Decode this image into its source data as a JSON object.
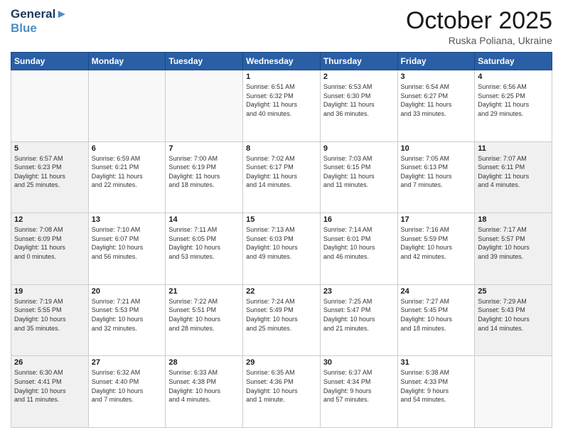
{
  "header": {
    "logo_line1": "General",
    "logo_line2": "Blue",
    "month": "October 2025",
    "location": "Ruska Poliana, Ukraine"
  },
  "weekdays": [
    "Sunday",
    "Monday",
    "Tuesday",
    "Wednesday",
    "Thursday",
    "Friday",
    "Saturday"
  ],
  "weeks": [
    [
      {
        "day": "",
        "info": "",
        "empty": true
      },
      {
        "day": "",
        "info": "",
        "empty": true
      },
      {
        "day": "",
        "info": "",
        "empty": true
      },
      {
        "day": "1",
        "info": "Sunrise: 6:51 AM\nSunset: 6:32 PM\nDaylight: 11 hours\nand 40 minutes."
      },
      {
        "day": "2",
        "info": "Sunrise: 6:53 AM\nSunset: 6:30 PM\nDaylight: 11 hours\nand 36 minutes."
      },
      {
        "day": "3",
        "info": "Sunrise: 6:54 AM\nSunset: 6:27 PM\nDaylight: 11 hours\nand 33 minutes."
      },
      {
        "day": "4",
        "info": "Sunrise: 6:56 AM\nSunset: 6:25 PM\nDaylight: 11 hours\nand 29 minutes."
      }
    ],
    [
      {
        "day": "5",
        "info": "Sunrise: 6:57 AM\nSunset: 6:23 PM\nDaylight: 11 hours\nand 25 minutes.",
        "shaded": true
      },
      {
        "day": "6",
        "info": "Sunrise: 6:59 AM\nSunset: 6:21 PM\nDaylight: 11 hours\nand 22 minutes."
      },
      {
        "day": "7",
        "info": "Sunrise: 7:00 AM\nSunset: 6:19 PM\nDaylight: 11 hours\nand 18 minutes."
      },
      {
        "day": "8",
        "info": "Sunrise: 7:02 AM\nSunset: 6:17 PM\nDaylight: 11 hours\nand 14 minutes."
      },
      {
        "day": "9",
        "info": "Sunrise: 7:03 AM\nSunset: 6:15 PM\nDaylight: 11 hours\nand 11 minutes."
      },
      {
        "day": "10",
        "info": "Sunrise: 7:05 AM\nSunset: 6:13 PM\nDaylight: 11 hours\nand 7 minutes."
      },
      {
        "day": "11",
        "info": "Sunrise: 7:07 AM\nSunset: 6:11 PM\nDaylight: 11 hours\nand 4 minutes.",
        "shaded": true
      }
    ],
    [
      {
        "day": "12",
        "info": "Sunrise: 7:08 AM\nSunset: 6:09 PM\nDaylight: 11 hours\nand 0 minutes.",
        "shaded": true
      },
      {
        "day": "13",
        "info": "Sunrise: 7:10 AM\nSunset: 6:07 PM\nDaylight: 10 hours\nand 56 minutes."
      },
      {
        "day": "14",
        "info": "Sunrise: 7:11 AM\nSunset: 6:05 PM\nDaylight: 10 hours\nand 53 minutes."
      },
      {
        "day": "15",
        "info": "Sunrise: 7:13 AM\nSunset: 6:03 PM\nDaylight: 10 hours\nand 49 minutes."
      },
      {
        "day": "16",
        "info": "Sunrise: 7:14 AM\nSunset: 6:01 PM\nDaylight: 10 hours\nand 46 minutes."
      },
      {
        "day": "17",
        "info": "Sunrise: 7:16 AM\nSunset: 5:59 PM\nDaylight: 10 hours\nand 42 minutes."
      },
      {
        "day": "18",
        "info": "Sunrise: 7:17 AM\nSunset: 5:57 PM\nDaylight: 10 hours\nand 39 minutes.",
        "shaded": true
      }
    ],
    [
      {
        "day": "19",
        "info": "Sunrise: 7:19 AM\nSunset: 5:55 PM\nDaylight: 10 hours\nand 35 minutes.",
        "shaded": true
      },
      {
        "day": "20",
        "info": "Sunrise: 7:21 AM\nSunset: 5:53 PM\nDaylight: 10 hours\nand 32 minutes."
      },
      {
        "day": "21",
        "info": "Sunrise: 7:22 AM\nSunset: 5:51 PM\nDaylight: 10 hours\nand 28 minutes."
      },
      {
        "day": "22",
        "info": "Sunrise: 7:24 AM\nSunset: 5:49 PM\nDaylight: 10 hours\nand 25 minutes."
      },
      {
        "day": "23",
        "info": "Sunrise: 7:25 AM\nSunset: 5:47 PM\nDaylight: 10 hours\nand 21 minutes."
      },
      {
        "day": "24",
        "info": "Sunrise: 7:27 AM\nSunset: 5:45 PM\nDaylight: 10 hours\nand 18 minutes."
      },
      {
        "day": "25",
        "info": "Sunrise: 7:29 AM\nSunset: 5:43 PM\nDaylight: 10 hours\nand 14 minutes.",
        "shaded": true
      }
    ],
    [
      {
        "day": "26",
        "info": "Sunrise: 6:30 AM\nSunset: 4:41 PM\nDaylight: 10 hours\nand 11 minutes.",
        "shaded": true
      },
      {
        "day": "27",
        "info": "Sunrise: 6:32 AM\nSunset: 4:40 PM\nDaylight: 10 hours\nand 7 minutes."
      },
      {
        "day": "28",
        "info": "Sunrise: 6:33 AM\nSunset: 4:38 PM\nDaylight: 10 hours\nand 4 minutes."
      },
      {
        "day": "29",
        "info": "Sunrise: 6:35 AM\nSunset: 4:36 PM\nDaylight: 10 hours\nand 1 minute."
      },
      {
        "day": "30",
        "info": "Sunrise: 6:37 AM\nSunset: 4:34 PM\nDaylight: 9 hours\nand 57 minutes."
      },
      {
        "day": "31",
        "info": "Sunrise: 6:38 AM\nSunset: 4:33 PM\nDaylight: 9 hours\nand 54 minutes."
      },
      {
        "day": "",
        "info": "",
        "empty": true
      }
    ]
  ]
}
